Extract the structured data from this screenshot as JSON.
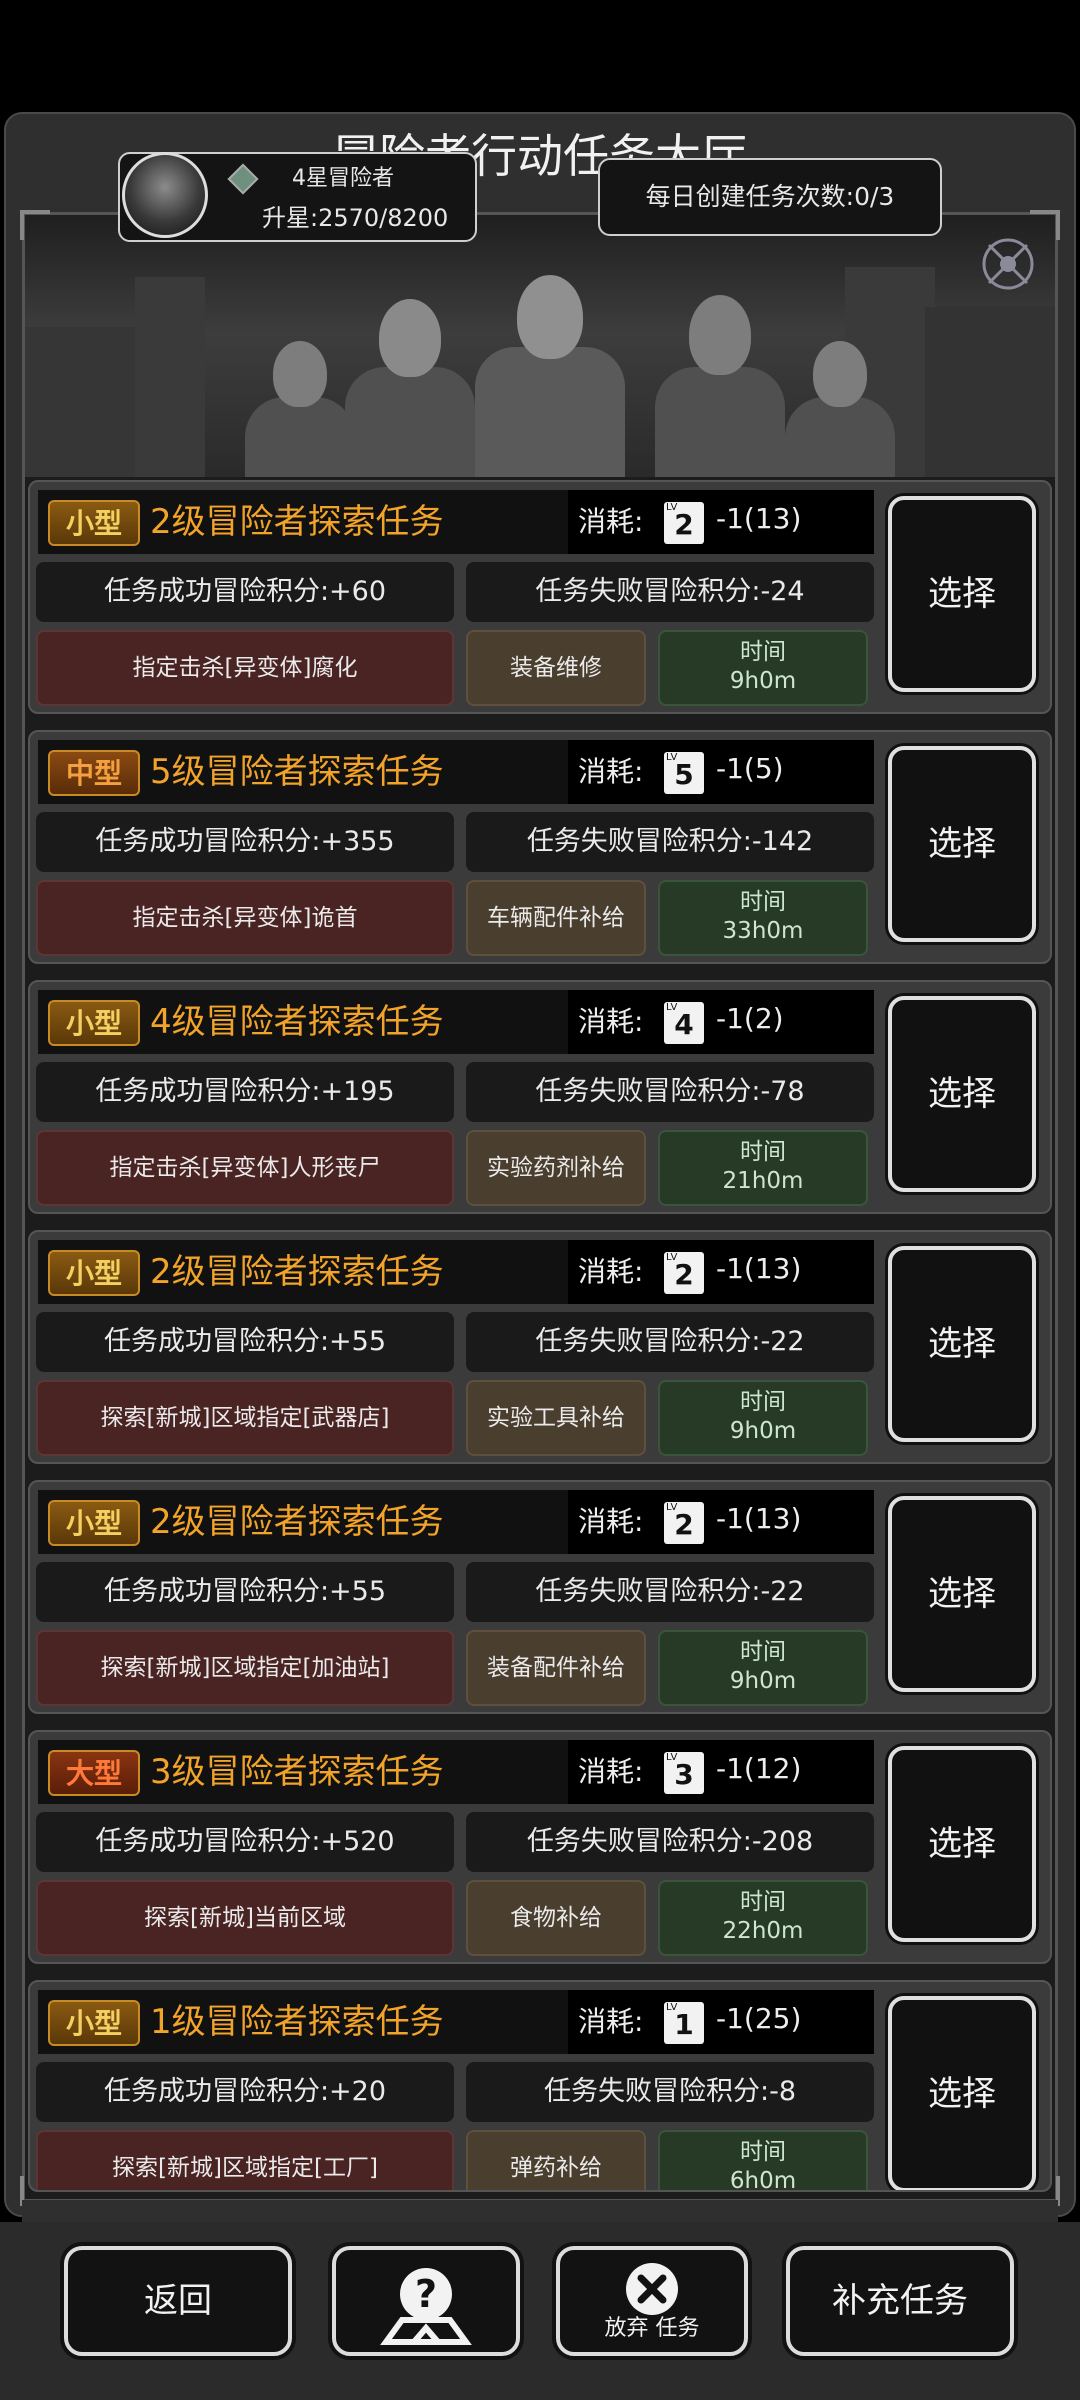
{
  "title": "冒险者行动任务大厅",
  "rank": {
    "name": "4星冒险者",
    "star_progress": "升星:2570/8200"
  },
  "daily": "每日创建任务次数:0/3",
  "cost_label": "消耗:",
  "choose_label": "选择",
  "time_label": "时间",
  "missions": [
    {
      "size": "小型",
      "size_class": "small",
      "name": "2级冒险者探索任务",
      "lv": "2",
      "cost": "-1(13)",
      "success": "任务成功冒险积分:+60",
      "fail": "任务失败冒险积分:-24",
      "target": "指定击杀[异变体]腐化",
      "supply": "装备维修",
      "time": "9h0m"
    },
    {
      "size": "中型",
      "size_class": "mid",
      "name": "5级冒险者探索任务",
      "lv": "5",
      "cost": "-1(5)",
      "success": "任务成功冒险积分:+355",
      "fail": "任务失败冒险积分:-142",
      "target": "指定击杀[异变体]诡首",
      "supply": "车辆配件补给",
      "time": "33h0m"
    },
    {
      "size": "小型",
      "size_class": "small",
      "name": "4级冒险者探索任务",
      "lv": "4",
      "cost": "-1(2)",
      "success": "任务成功冒险积分:+195",
      "fail": "任务失败冒险积分:-78",
      "target": "指定击杀[异变体]人形丧尸",
      "supply": "实验药剂补给",
      "time": "21h0m"
    },
    {
      "size": "小型",
      "size_class": "small",
      "name": "2级冒险者探索任务",
      "lv": "2",
      "cost": "-1(13)",
      "success": "任务成功冒险积分:+55",
      "fail": "任务失败冒险积分:-22",
      "target": "探索[新城]区域指定[武器店]",
      "supply": "实验工具补给",
      "time": "9h0m"
    },
    {
      "size": "小型",
      "size_class": "small",
      "name": "2级冒险者探索任务",
      "lv": "2",
      "cost": "-1(13)",
      "success": "任务成功冒险积分:+55",
      "fail": "任务失败冒险积分:-22",
      "target": "探索[新城]区域指定[加油站]",
      "supply": "装备配件补给",
      "time": "9h0m"
    },
    {
      "size": "大型",
      "size_class": "big",
      "name": "3级冒险者探索任务",
      "lv": "3",
      "cost": "-1(12)",
      "success": "任务成功冒险积分:+520",
      "fail": "任务失败冒险积分:-208",
      "target": "探索[新城]当前区域",
      "supply": "食物补给",
      "time": "22h0m"
    },
    {
      "size": "小型",
      "size_class": "small",
      "name": "1级冒险者探索任务",
      "lv": "1",
      "cost": "-1(25)",
      "success": "任务成功冒险积分:+20",
      "fail": "任务失败冒险积分:-8",
      "target": "探索[新城]区域指定[工厂]",
      "supply": "弹药补给",
      "time": "6h0m"
    }
  ],
  "bottom": {
    "back": "返回",
    "quit": "放弃 任务",
    "refill": "补充任务"
  }
}
